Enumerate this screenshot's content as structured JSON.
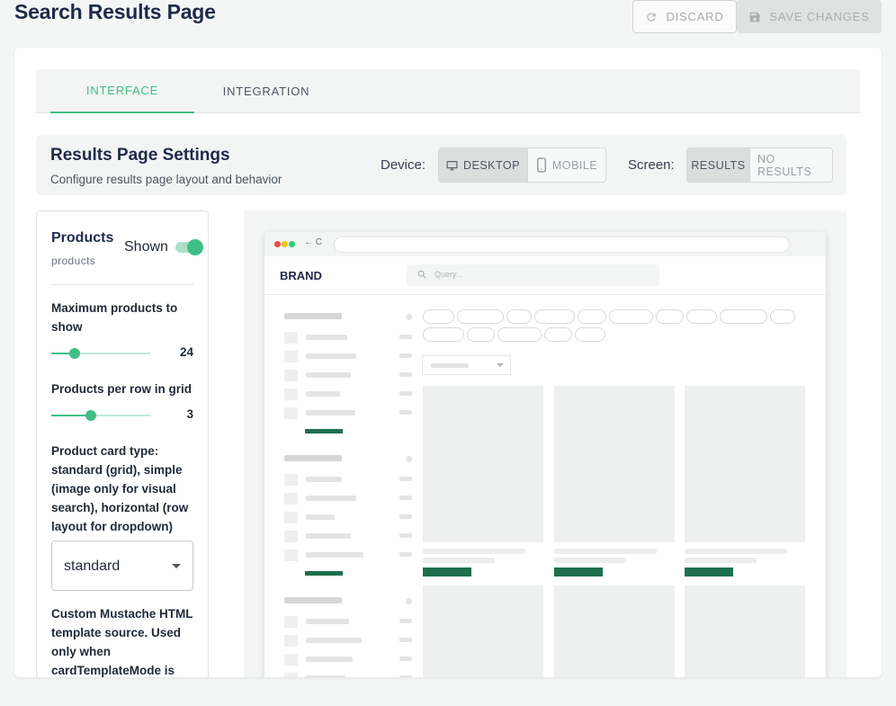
{
  "page": {
    "title": "Search Results Page",
    "discard_label": "DISCARD",
    "save_label": "SAVE CHANGES"
  },
  "tabs": [
    {
      "label": "INTERFACE",
      "active": true
    },
    {
      "label": "INTEGRATION",
      "active": false
    }
  ],
  "settings": {
    "title": "Results Page Settings",
    "subtitle": "Configure results page layout and behavior",
    "device_label": "Device:",
    "device_options": [
      "DESKTOP",
      "MOBILE"
    ],
    "device_selected": "DESKTOP",
    "screen_label": "Screen:",
    "screen_options": [
      "RESULTS",
      "NO RESULTS"
    ],
    "screen_selected": "RESULTS"
  },
  "products": {
    "title": "Products",
    "key": "products",
    "shown_label": "Shown",
    "shown": true,
    "max_products_label": "Maximum products to show",
    "max_products_value": "24",
    "per_row_label": "Products per row in grid",
    "per_row_value": "3",
    "card_type_label": "Product card type: standard (grid), simple (image only for visual search), horizontal (row layout for dropdown)",
    "card_type_value": "standard",
    "template_label": "Custom Mustache HTML template source. Used only when cardTemplateMode is"
  },
  "preview": {
    "brand": "BRAND",
    "search_placeholder": "Query...",
    "nav_glyphs": "← C"
  },
  "colors": {
    "accent": "#3fbf86",
    "brand_dark": "#1e6f4f",
    "title": "#1e2a4a"
  }
}
